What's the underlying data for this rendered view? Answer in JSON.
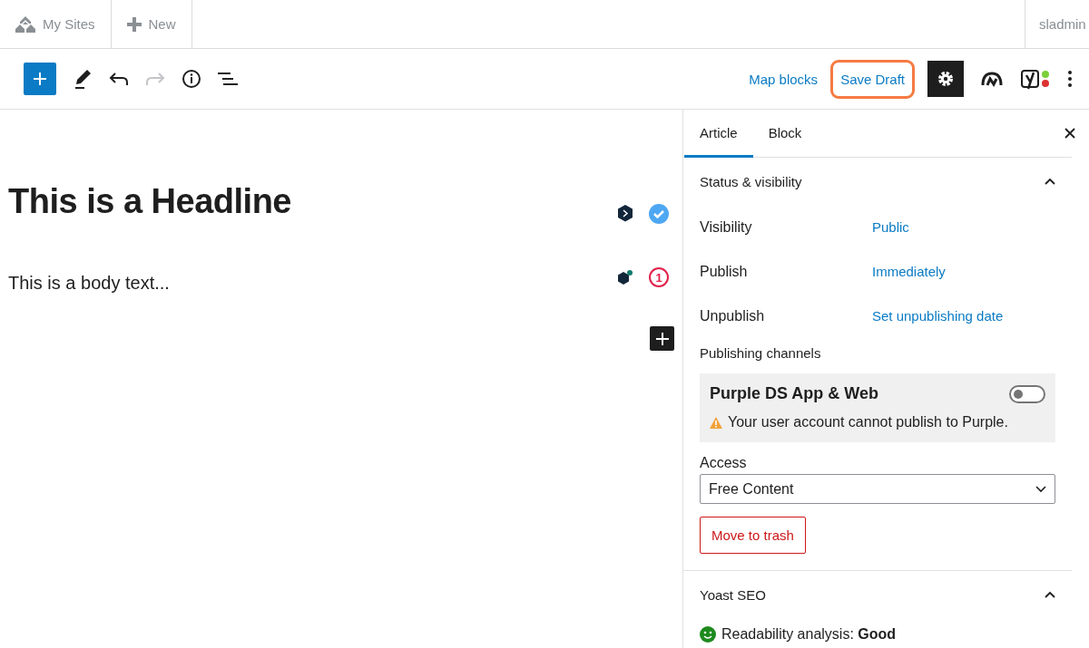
{
  "topbar": {
    "my_sites": "My Sites",
    "new": "New",
    "user": "sladmin"
  },
  "toolbar": {
    "map_blocks": "Map blocks",
    "save_draft": {
      "label": "Save Draft",
      "highlighted": true
    },
    "redo_disabled": true
  },
  "editor": {
    "headline": "This is a Headline",
    "body": "This is a body text...",
    "body_issues": "1"
  },
  "sidebar": {
    "tabs": [
      {
        "label": "Article",
        "selected": true
      },
      {
        "label": "Block",
        "selected": false
      }
    ],
    "status": {
      "title": "Status & visibility",
      "expanded": true,
      "rows": [
        {
          "label": "Visibility",
          "value": "Public"
        },
        {
          "label": "Publish",
          "value": "Immediately"
        },
        {
          "label": "Unpublish",
          "value": "Set unpublishing date"
        }
      ],
      "channels_label": "Publishing channels",
      "channel": {
        "name": "Purple DS App & Web",
        "on": false,
        "warning": "Your user account cannot publish to Purple."
      },
      "access": {
        "label": "Access",
        "value": "Free Content"
      },
      "trash": "Move to trash"
    },
    "yoast": {
      "title": "Yoast SEO",
      "expanded": true,
      "readability": "Readability analysis: **Good**"
    }
  }
}
